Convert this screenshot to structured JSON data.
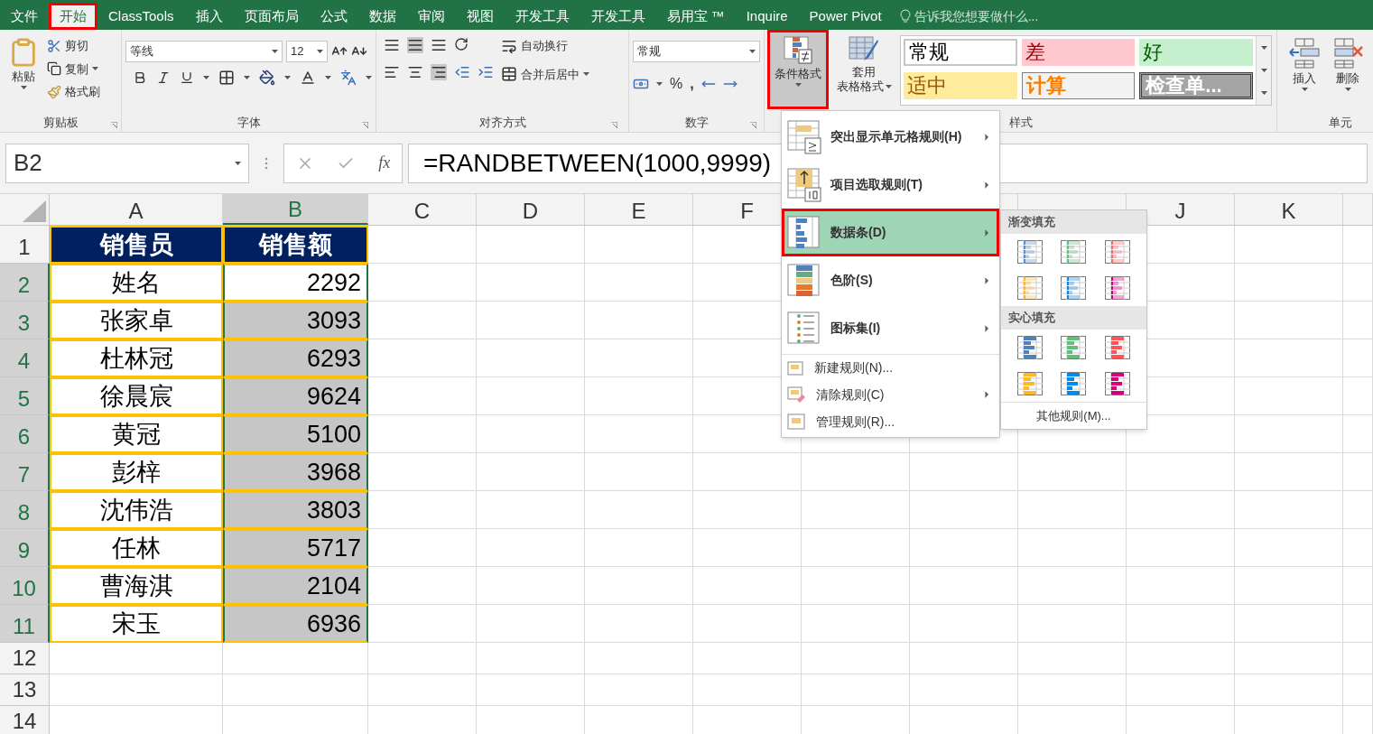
{
  "ribbon_tabs": [
    {
      "label": "文件",
      "selected": false,
      "highlighted": false
    },
    {
      "label": "开始",
      "selected": true,
      "highlighted": true
    },
    {
      "label": "ClassTools",
      "selected": false,
      "highlighted": false
    },
    {
      "label": "插入",
      "selected": false,
      "highlighted": false
    },
    {
      "label": "页面布局",
      "selected": false,
      "highlighted": false
    },
    {
      "label": "公式",
      "selected": false,
      "highlighted": false
    },
    {
      "label": "数据",
      "selected": false,
      "highlighted": false
    },
    {
      "label": "审阅",
      "selected": false,
      "highlighted": false
    },
    {
      "label": "视图",
      "selected": false,
      "highlighted": false
    },
    {
      "label": "开发工具",
      "selected": false,
      "highlighted": false
    },
    {
      "label": "开发工具",
      "selected": false,
      "highlighted": false
    },
    {
      "label": "易用宝 ™",
      "selected": false,
      "highlighted": false
    },
    {
      "label": "Inquire",
      "selected": false,
      "highlighted": false
    },
    {
      "label": "Power Pivot",
      "selected": false,
      "highlighted": false
    }
  ],
  "tell_me": "告诉我您想要做什么...",
  "clipboard": {
    "paste": "粘贴",
    "cut": "剪切",
    "copy": "复制",
    "format_painter": "格式刷",
    "label": "剪贴板"
  },
  "font": {
    "name": "等线",
    "size": "12",
    "label": "字体"
  },
  "alignment": {
    "wrap": "自动换行",
    "merge": "合并后居中",
    "label": "对齐方式"
  },
  "number": {
    "format": "常规",
    "percent": "%",
    "comma": ",",
    "label": "数字"
  },
  "styles": {
    "conditional_format": "条件格式",
    "conditional_highlighted": true,
    "table_format_top": "套用",
    "table_format_bottom": "表格格式",
    "label": "样式",
    "cell_styles": [
      {
        "label": "常规",
        "kind": "normal"
      },
      {
        "label": "差",
        "kind": "bad"
      },
      {
        "label": "好",
        "kind": "good"
      },
      {
        "label": "适中",
        "kind": "neutral"
      },
      {
        "label": "计算",
        "kind": "calc"
      },
      {
        "label": "检查单...",
        "kind": "check"
      }
    ]
  },
  "cells_group": {
    "insert": "插入",
    "delete": "删除",
    "label": "单元"
  },
  "formula_bar": {
    "name_box": "B2",
    "function_label": "fx",
    "formula": "=RANDBETWEEN(1000,9999)"
  },
  "columns": [
    {
      "label": "A",
      "selected": false
    },
    {
      "label": "B",
      "selected": true
    },
    {
      "label": "C",
      "selected": false
    },
    {
      "label": "D",
      "selected": false
    },
    {
      "label": "E",
      "selected": false
    },
    {
      "label": "F",
      "selected": false
    },
    {
      "label": "J",
      "selected": false
    },
    {
      "label": "K",
      "selected": false
    }
  ],
  "rows": [
    {
      "number": "1",
      "selected": false,
      "cells": [
        {
          "text": "销售员",
          "kind": "header"
        },
        {
          "text": "销售额",
          "kind": "header"
        }
      ]
    },
    {
      "number": "2",
      "selected": true,
      "cells": [
        {
          "text": "姓名",
          "kind": "name"
        },
        {
          "text": "2292",
          "kind": "amount",
          "selected": true,
          "active": true
        }
      ]
    },
    {
      "number": "3",
      "selected": true,
      "cells": [
        {
          "text": "张家卓",
          "kind": "name"
        },
        {
          "text": "3093",
          "kind": "amount",
          "selected": true,
          "active": false
        }
      ]
    },
    {
      "number": "4",
      "selected": true,
      "cells": [
        {
          "text": "杜林冠",
          "kind": "name"
        },
        {
          "text": "6293",
          "kind": "amount",
          "selected": true,
          "active": false
        }
      ]
    },
    {
      "number": "5",
      "selected": true,
      "cells": [
        {
          "text": "徐晨宸",
          "kind": "name"
        },
        {
          "text": "9624",
          "kind": "amount",
          "selected": true,
          "active": false
        }
      ]
    },
    {
      "number": "6",
      "selected": true,
      "cells": [
        {
          "text": "黄冠",
          "kind": "name"
        },
        {
          "text": "5100",
          "kind": "amount",
          "selected": true,
          "active": false
        }
      ]
    },
    {
      "number": "7",
      "selected": true,
      "cells": [
        {
          "text": "彭梓",
          "kind": "name"
        },
        {
          "text": "3968",
          "kind": "amount",
          "selected": true,
          "active": false
        }
      ]
    },
    {
      "number": "8",
      "selected": true,
      "cells": [
        {
          "text": "沈伟浩",
          "kind": "name"
        },
        {
          "text": "3803",
          "kind": "amount",
          "selected": true,
          "active": false
        }
      ]
    },
    {
      "number": "9",
      "selected": true,
      "cells": [
        {
          "text": "任林",
          "kind": "name"
        },
        {
          "text": "5717",
          "kind": "amount",
          "selected": true,
          "active": false
        }
      ]
    },
    {
      "number": "10",
      "selected": true,
      "cells": [
        {
          "text": "曹海淇",
          "kind": "name"
        },
        {
          "text": "2104",
          "kind": "amount",
          "selected": true,
          "active": false
        }
      ]
    },
    {
      "number": "11",
      "selected": true,
      "cells": [
        {
          "text": "宋玉",
          "kind": "name"
        },
        {
          "text": "6936",
          "kind": "amount",
          "selected": true,
          "active": false
        }
      ]
    },
    {
      "number": "12",
      "selected": false,
      "cells": []
    },
    {
      "number": "13",
      "selected": false,
      "cells": []
    },
    {
      "number": "14",
      "selected": false,
      "cells": []
    }
  ],
  "menu": {
    "items": [
      {
        "kind": "large",
        "label": "突出显示单元格规则(H)",
        "selected": false,
        "submenu": true
      },
      {
        "kind": "large",
        "label": "项目选取规则(T)",
        "selected": false,
        "submenu": true
      },
      {
        "kind": "large",
        "label": "数据条(D)",
        "selected": true,
        "submenu": true
      },
      {
        "kind": "large",
        "label": "色阶(S)",
        "selected": false,
        "submenu": true
      },
      {
        "kind": "large",
        "label": "图标集(I)",
        "selected": false,
        "submenu": true
      },
      {
        "kind": "small",
        "label": "新建规则(N)...",
        "selected": false,
        "submenu": false
      },
      {
        "kind": "small",
        "label": "清除规则(C)",
        "selected": false,
        "submenu": true
      },
      {
        "kind": "small",
        "label": "管理规则(R)...",
        "selected": false,
        "submenu": false
      }
    ]
  },
  "submenu": {
    "sections": [
      {
        "title": "渐变填充",
        "kind": "gradient",
        "swatches": [
          {
            "color": "#5b8fcf"
          },
          {
            "color": "#63be7b"
          },
          {
            "color": "#f8696b"
          },
          {
            "color": "#ffb628"
          },
          {
            "color": "#008aef"
          },
          {
            "color": "#d6007b"
          }
        ]
      },
      {
        "title": "实心填充",
        "kind": "solid",
        "swatches": [
          {
            "color": "#4f81bd"
          },
          {
            "color": "#63be7b"
          },
          {
            "color": "#ff555a"
          },
          {
            "color": "#ffb628"
          },
          {
            "color": "#008aef"
          },
          {
            "color": "#d6007b"
          }
        ]
      }
    ],
    "footer": "其他规则(M)..."
  }
}
